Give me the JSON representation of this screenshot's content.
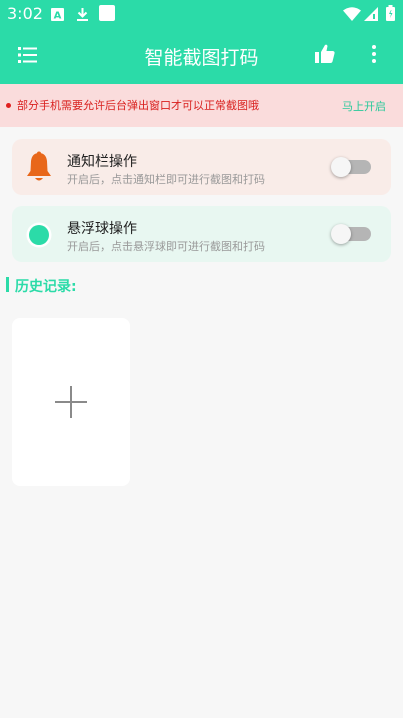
{
  "status_bar": {
    "time": "3:02",
    "icons": [
      "a-notification-icon",
      "download-icon",
      "app-square-icon",
      "wifi-icon",
      "signal-icon",
      "battery-icon"
    ]
  },
  "app_bar": {
    "title": "智能截图打码",
    "icons": [
      "menu-list-icon",
      "thumbs-up-icon",
      "more-vert-icon"
    ]
  },
  "notice": {
    "text": "部分手机需要允许后台弹出窗口才可以正常截图哦",
    "action": "马上开启"
  },
  "cards": [
    {
      "title": "通知栏操作",
      "subtitle": "开启后，点击通知栏即可进行截图和打码",
      "icon": "bell-icon",
      "enabled": false,
      "background": "#f9ece8"
    },
    {
      "title": "悬浮球操作",
      "subtitle": "开启后，点击悬浮球即可进行截图和打码",
      "icon": "floating-ball-icon",
      "enabled": false,
      "background": "#e8f7f1"
    }
  ],
  "history": {
    "title": "历史记录:"
  },
  "colors": {
    "accent": "#2bdba8",
    "notice_bg": "#fadcdc",
    "notice_text": "#d9201e",
    "bell": "#e8671a"
  }
}
